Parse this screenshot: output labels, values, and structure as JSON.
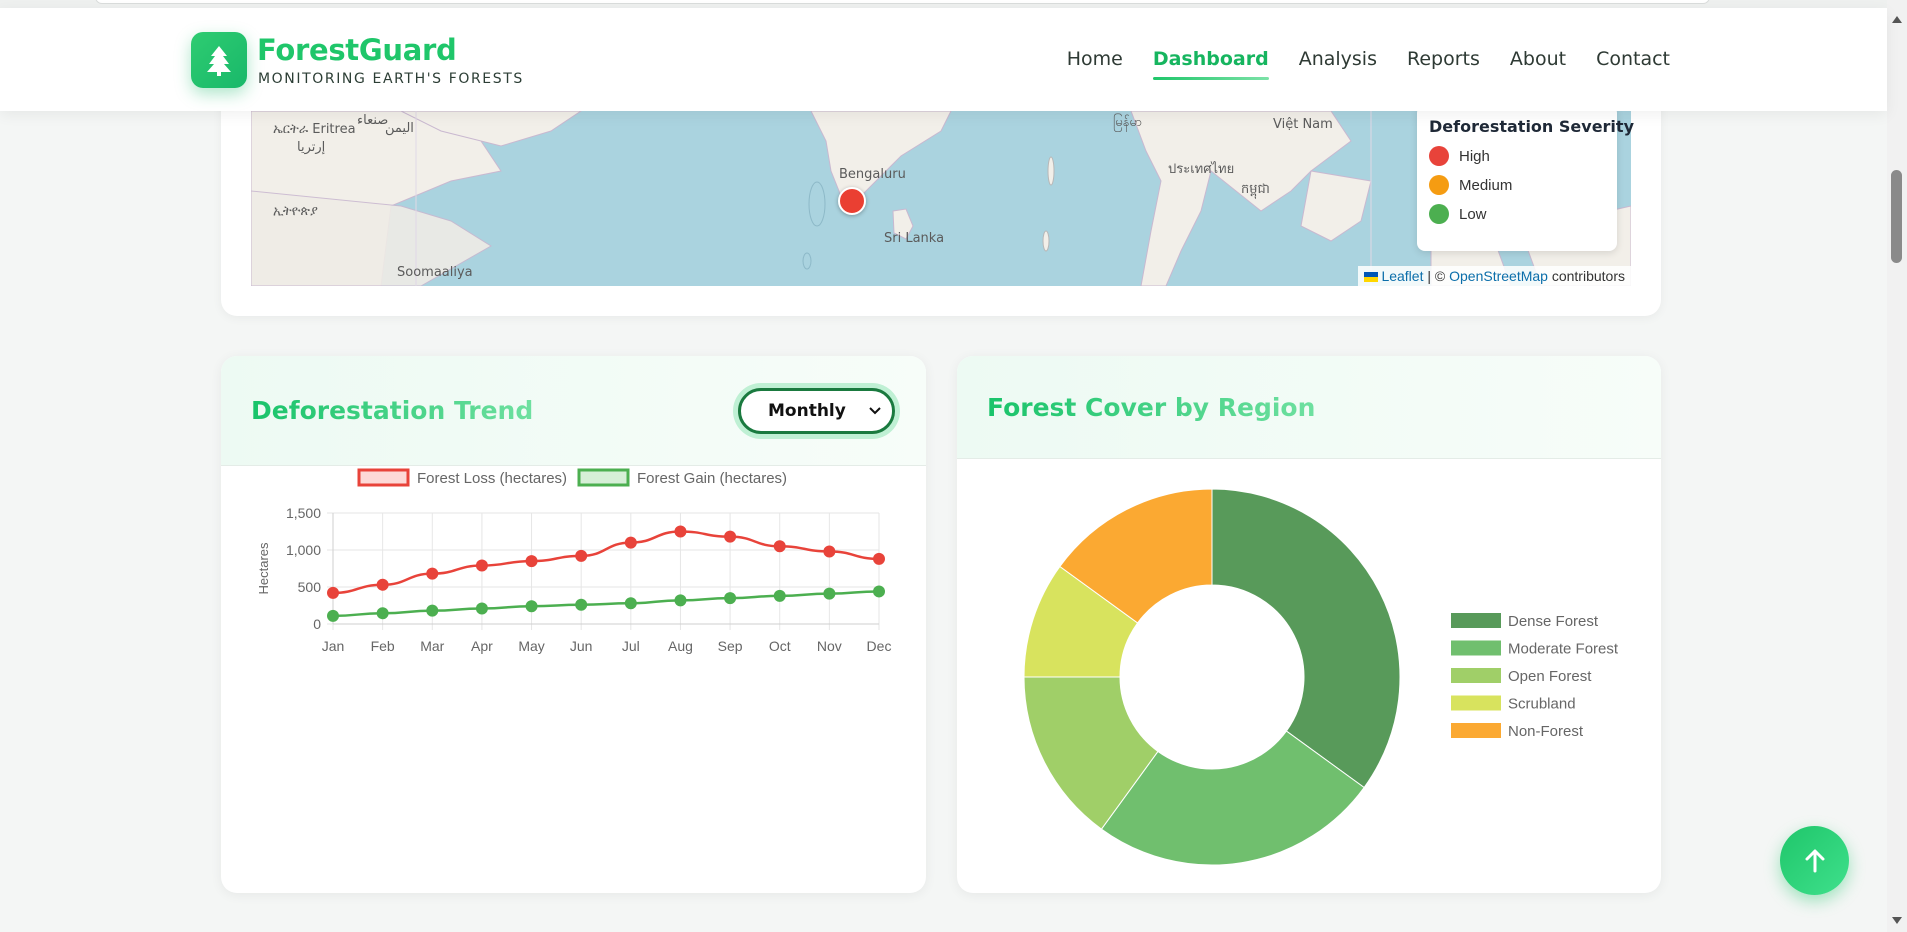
{
  "brand": {
    "name": "ForestGuard",
    "tagline": "MONITORING EARTH'S FORESTS",
    "icon": "tree-icon"
  },
  "nav": {
    "items": [
      {
        "label": "Home",
        "active": false
      },
      {
        "label": "Dashboard",
        "active": true
      },
      {
        "label": "Analysis",
        "active": false
      },
      {
        "label": "Reports",
        "active": false
      },
      {
        "label": "About",
        "active": false
      },
      {
        "label": "Contact",
        "active": false
      }
    ]
  },
  "map": {
    "labels": {
      "eritrea": "ኤርትራ Eritrea",
      "eritrea2": "إرتريا",
      "yemen": "اليمن",
      "sanaa": "صنعاء",
      "ethiopia": "ኢትዮጵያ",
      "somalia": "Soomaaliya",
      "bengaluru": "Bengaluru",
      "srilanka": "Sri Lanka",
      "myanmar": "မြန်မာ",
      "thailand": "ประเทศไทย",
      "cambodia": "កម្ពុជា",
      "vietnam": "Việt Nam"
    },
    "legend": {
      "title": "Deforestation Severity",
      "items": [
        {
          "label": "High",
          "color": "#e8433a"
        },
        {
          "label": "Medium",
          "color": "#f59c12"
        },
        {
          "label": "Low",
          "color": "#4caf50"
        }
      ]
    },
    "attribution": {
      "leaflet": "Leaflet",
      "sep": " | © ",
      "osm": "OpenStreetMap",
      "suffix": " contributors"
    },
    "marker_severity": "High"
  },
  "trend": {
    "title": "Deforestation Trend",
    "period": "Monthly",
    "chart_data": {
      "type": "line",
      "x": [
        "Jan",
        "Feb",
        "Mar",
        "Apr",
        "May",
        "Jun",
        "Jul",
        "Aug",
        "Sep",
        "Oct",
        "Nov",
        "Dec"
      ],
      "ylabel": "Hectares",
      "ylim": [
        0,
        1500
      ],
      "yticks": [
        "0",
        "500",
        "1,000",
        "1,500"
      ],
      "grid": true,
      "legend": "top",
      "series": [
        {
          "name": "Forest Loss (hectares)",
          "color": "#e8433a",
          "fill": "#fdd9d7",
          "values": [
            420,
            530,
            680,
            790,
            850,
            920,
            1100,
            1250,
            1180,
            1050,
            980,
            880
          ]
        },
        {
          "name": "Forest Gain (hectares)",
          "color": "#4caf50",
          "fill": "#d6efd7",
          "values": [
            110,
            145,
            180,
            210,
            240,
            260,
            280,
            320,
            350,
            380,
            410,
            440
          ]
        }
      ]
    }
  },
  "region": {
    "title": "Forest Cover by Region",
    "chart_data": {
      "type": "pie",
      "donut": true,
      "legend": "right",
      "categories": [
        "Dense Forest",
        "Moderate Forest",
        "Open Forest",
        "Scrubland",
        "Non-Forest"
      ],
      "values": [
        35,
        25,
        15,
        10,
        15
      ],
      "colors": [
        "#589a5a",
        "#70bf6e",
        "#a0cf68",
        "#d8e35e",
        "#fba932"
      ]
    }
  },
  "icons": {
    "scroll_top": "arrow-up-icon",
    "select_chevron": "chevron-down-icon"
  }
}
